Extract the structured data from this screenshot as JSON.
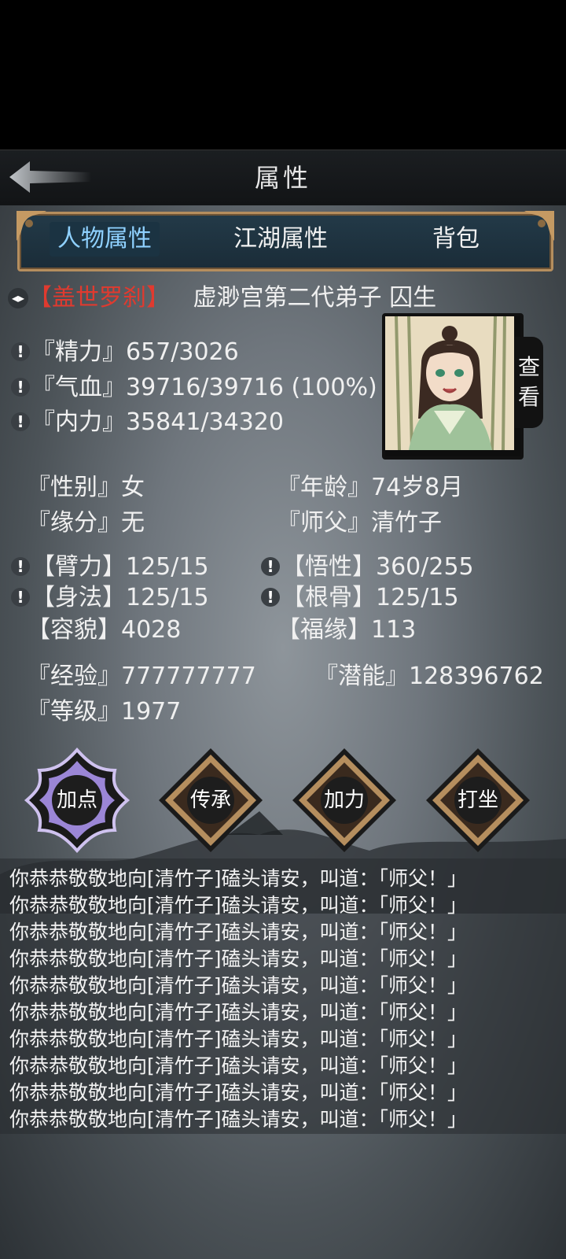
{
  "header": {
    "title": "属性",
    "back_icon": "back-arrow-icon"
  },
  "tabs": {
    "character": "人物属性",
    "jianghu": "江湖属性",
    "bag": "背包"
  },
  "profile": {
    "title_tag": "【盖世罗刹】",
    "sect_and_name": "虚渺宫第二代弟子 囚生",
    "view_label_1": "查",
    "view_label_2": "看"
  },
  "vitals": {
    "energy_label": "『精力』",
    "energy_value": "657/3026",
    "hp_label": "『气血』",
    "hp_value": "39716/39716 (100%)",
    "mp_label": "『内力』",
    "mp_value": "35841/34320"
  },
  "info": {
    "gender_label": "『性别』",
    "gender_value": "女",
    "age_label": "『年龄』",
    "age_value": "74岁8月",
    "fate_label": "『缘分』",
    "fate_value": "无",
    "master_label": "『师父』",
    "master_value": "清竹子"
  },
  "attributes": {
    "arm_label": "【臂力】",
    "arm_value": "125/15",
    "insight_label": "【悟性】",
    "insight_value": "360/255",
    "agility_label": "【身法】",
    "agility_value": "125/15",
    "bone_label": "【根骨】",
    "bone_value": "125/15",
    "looks_label": "【容貌】",
    "looks_value": "4028",
    "luck_label": "【福缘】",
    "luck_value": "113"
  },
  "progress": {
    "exp_label": "『经验』",
    "exp_value": "777777777",
    "potential_label": "『潜能』",
    "potential_value": "128396762",
    "level_label": "『等级』",
    "level_value": "1977"
  },
  "actions": {
    "add_points": "加点",
    "inherit": "传承",
    "add_strength": "加力",
    "meditate": "打坐"
  },
  "log": [
    "你恭恭敬敬地向[清竹子]磕头请安，叫道：「师父！」",
    "你恭恭敬敬地向[清竹子]磕头请安，叫道：「师父！」",
    "你恭恭敬敬地向[清竹子]磕头请安，叫道：「师父！」",
    "你恭恭敬敬地向[清竹子]磕头请安，叫道：「师父！」",
    "你恭恭敬敬地向[清竹子]磕头请安，叫道：「师父！」",
    "你恭恭敬敬地向[清竹子]磕头请安，叫道：「师父！」",
    "你恭恭敬敬地向[清竹子]磕头请安，叫道：「师父！」",
    "你恭恭敬敬地向[清竹子]磕头请安，叫道：「师父！」",
    "你恭恭敬敬地向[清竹子]磕头请安，叫道：「师父！」",
    "你恭恭敬敬地向[清竹子]磕头请安，叫道：「师父！」"
  ],
  "colors": {
    "accent_red": "#e03a2f",
    "active_tab_text": "#8fd1ff",
    "active_action": "#9b86d6",
    "frame_gold": "#b58e5e"
  }
}
